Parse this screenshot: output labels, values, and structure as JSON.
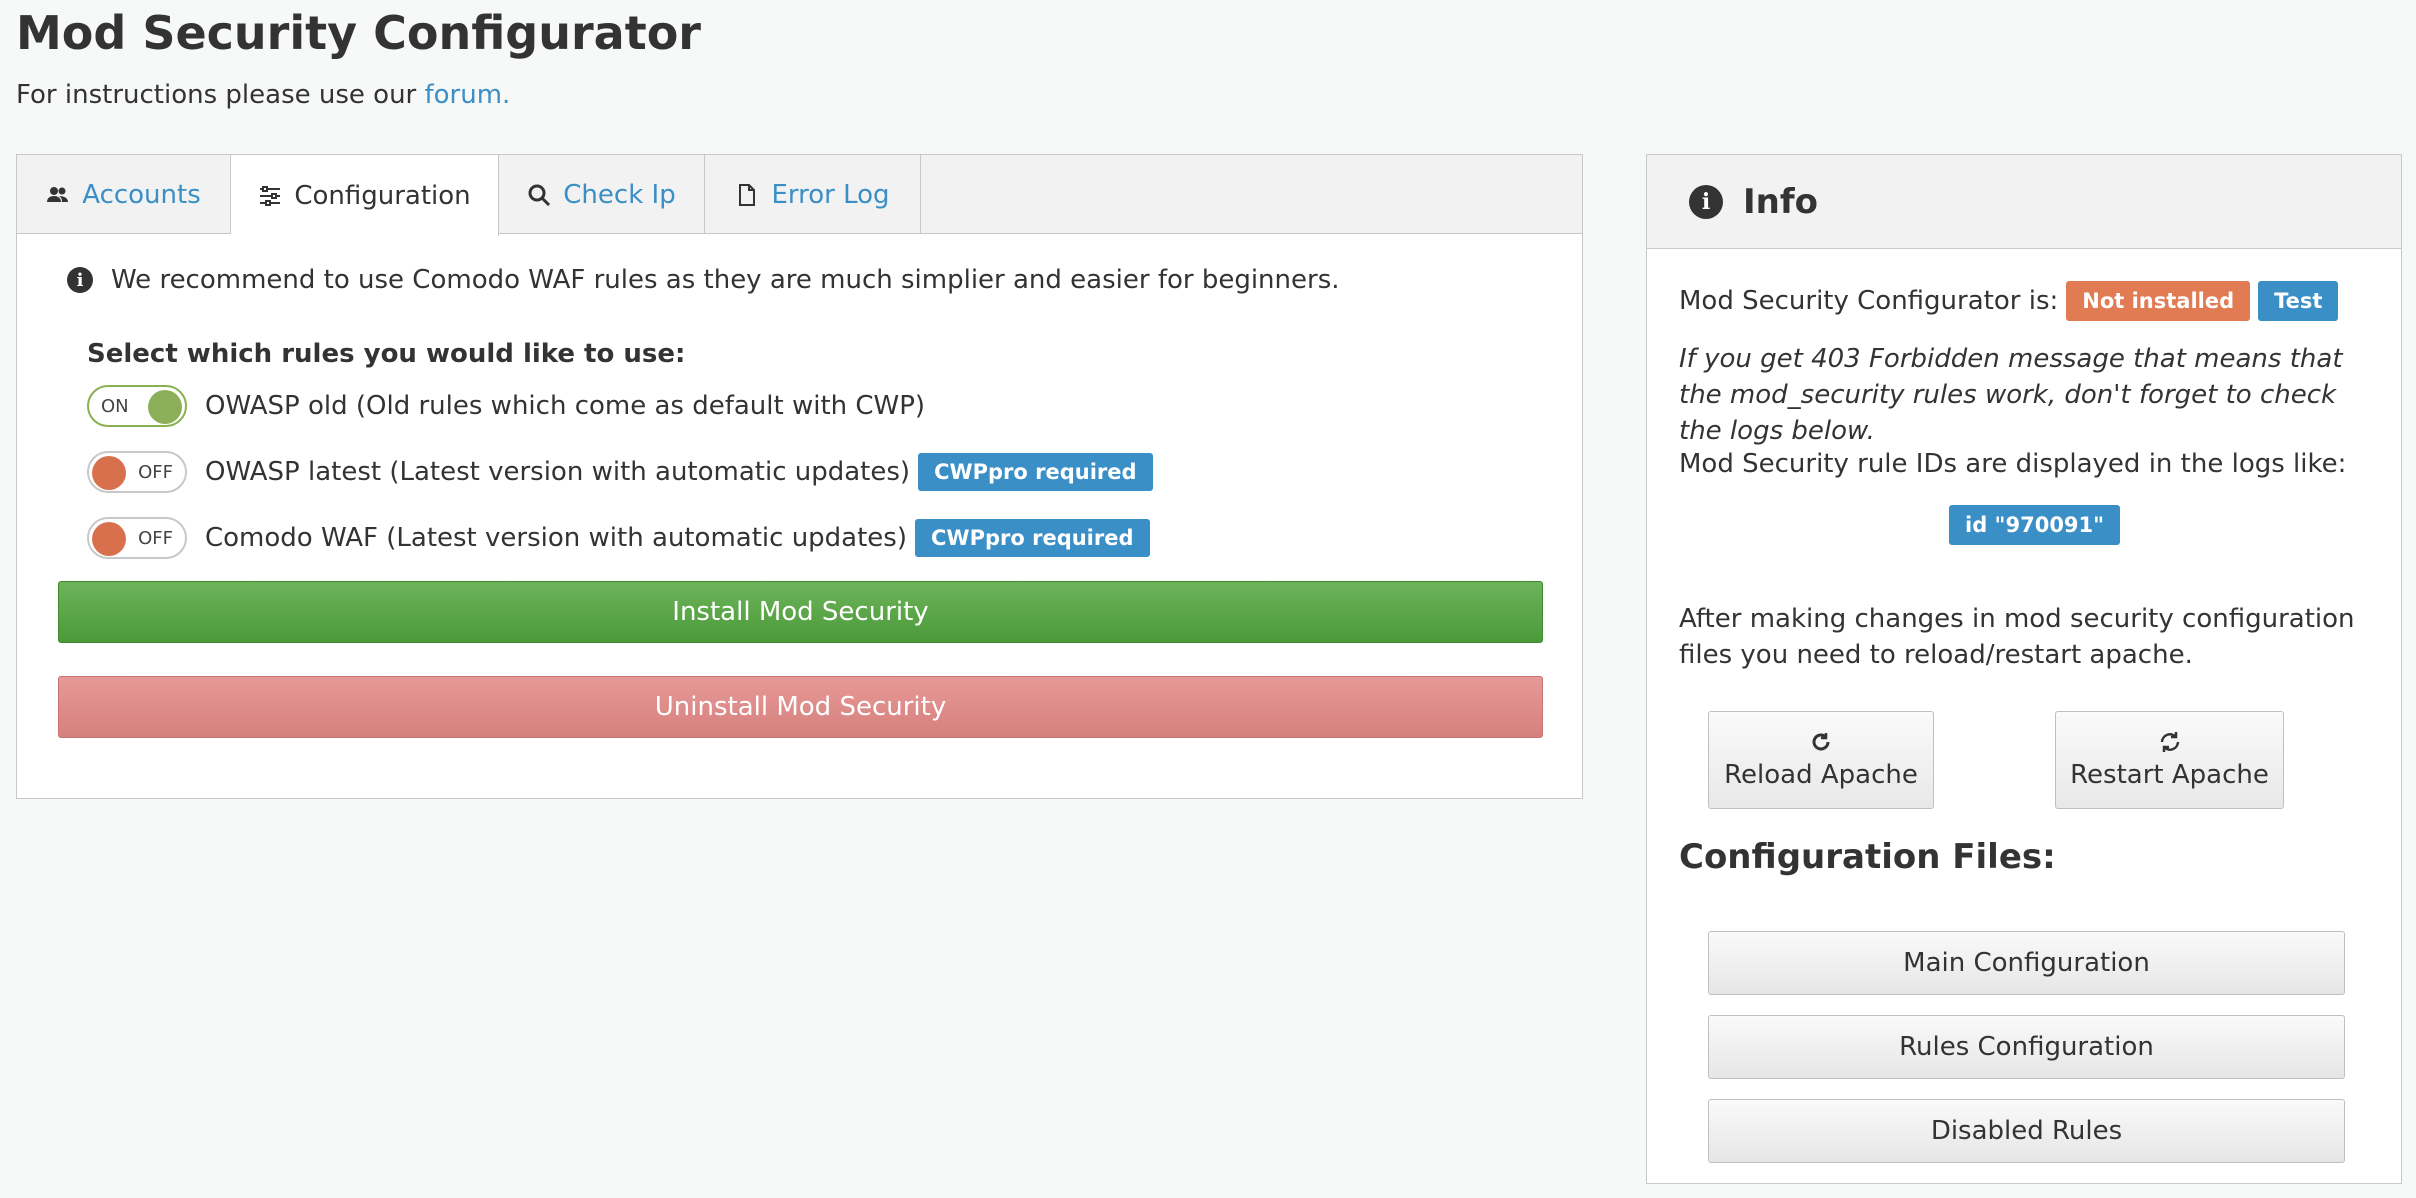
{
  "header": {
    "title": "Mod Security Configurator",
    "subtitle": "For instructions please use our ",
    "forum_link": "forum."
  },
  "tabs": [
    {
      "label": "Accounts",
      "icon": "users-icon",
      "active": false
    },
    {
      "label": "Configuration",
      "icon": "sliders-icon",
      "active": true
    },
    {
      "label": "Check Ip",
      "icon": "search-icon",
      "active": false
    },
    {
      "label": "Error Log",
      "icon": "file-icon",
      "active": false
    }
  ],
  "configuration": {
    "recommend": "We recommend to use Comodo WAF rules as they are much simplier and easier for beginners.",
    "rules_heading": "Select which rules you would like to use:",
    "rules": [
      {
        "label": "OWASP old (Old rules which come as default with CWP)",
        "state": "ON",
        "badge": ""
      },
      {
        "label": "OWASP latest (Latest version with automatic updates)",
        "state": "OFF",
        "badge": "CWPpro required"
      },
      {
        "label": "Comodo WAF (Latest version with automatic updates)",
        "state": "OFF",
        "badge": "CWPpro required"
      }
    ],
    "install_label": "Install Mod Security",
    "uninstall_label": "Uninstall Mod Security"
  },
  "info": {
    "title": "Info",
    "status_prefix": "Mod Security Configurator is:",
    "status_badge": "Not installed",
    "test_label": "Test",
    "note": "If you get 403 Forbidden message that means that the mod_security rules work, don't forget to check the logs below.",
    "ids_text": "Mod Security rule IDs are displayed in the logs like:",
    "id_example": "id \"970091\"",
    "after_text": "After making changes in mod security configuration files you need to reload/restart apache.",
    "reload_label": "Reload Apache",
    "restart_label": "Restart Apache",
    "conf_heading": "Configuration Files:",
    "conf_buttons": [
      "Main Configuration",
      "Rules Configuration",
      "Disabled Rules"
    ]
  },
  "colors": {
    "link": "#3a8fc7",
    "success": "#5aa847",
    "danger": "#d9817f",
    "warning": "#e07b53",
    "info": "#3a8fc7"
  }
}
